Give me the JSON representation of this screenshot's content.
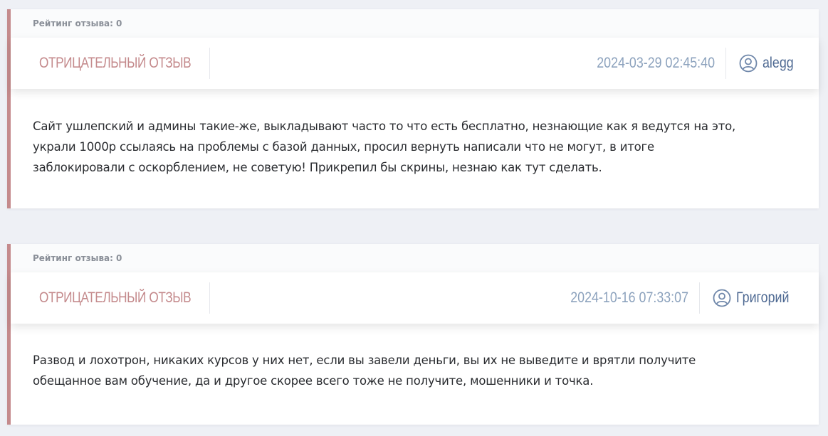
{
  "reviews": [
    {
      "rating_label": "Рейтинг отзыва:",
      "rating_value": "0",
      "type_label": "ОТРИЦАТЕЛЬНЫЙ ОТЗЫВ",
      "type_icon": "shield-star-icon",
      "date": "2024-03-29 02:45:40",
      "user_icon": "user-circle-icon",
      "username": "alegg",
      "text": "Сайт ушлепский и админы такие-же, выкладывают часто то что есть бесплатно, незнающие как я ведутся на это,\n украли 1000р ссылаясь на проблемы с базой данных, просил вернуть написали что не могут, в итоге\nзаблокировали с оскорблением, не советую! Прикрепил бы скрины, незнаю как тут сделать."
    },
    {
      "rating_label": "Рейтинг отзыва:",
      "rating_value": "0",
      "type_label": "ОТРИЦАТЕЛЬНЫЙ ОТЗЫВ",
      "type_icon": "shield-star-icon",
      "date": "2024-10-16 07:33:07",
      "user_icon": "user-circle-icon",
      "username": "Григорий",
      "text": "Развод и лохотрон, никаких курсов у них нет, если вы завели деньги, вы их не выведите и врятли получите\nобещанное вам обучение, да и другое скорее всего тоже не получите, мошенники и точка."
    }
  ],
  "colors": {
    "negative_accent": "#c48a8c",
    "date_color": "#8ca2bd",
    "username_color": "#4f6a93",
    "background": "#eef0f5"
  }
}
